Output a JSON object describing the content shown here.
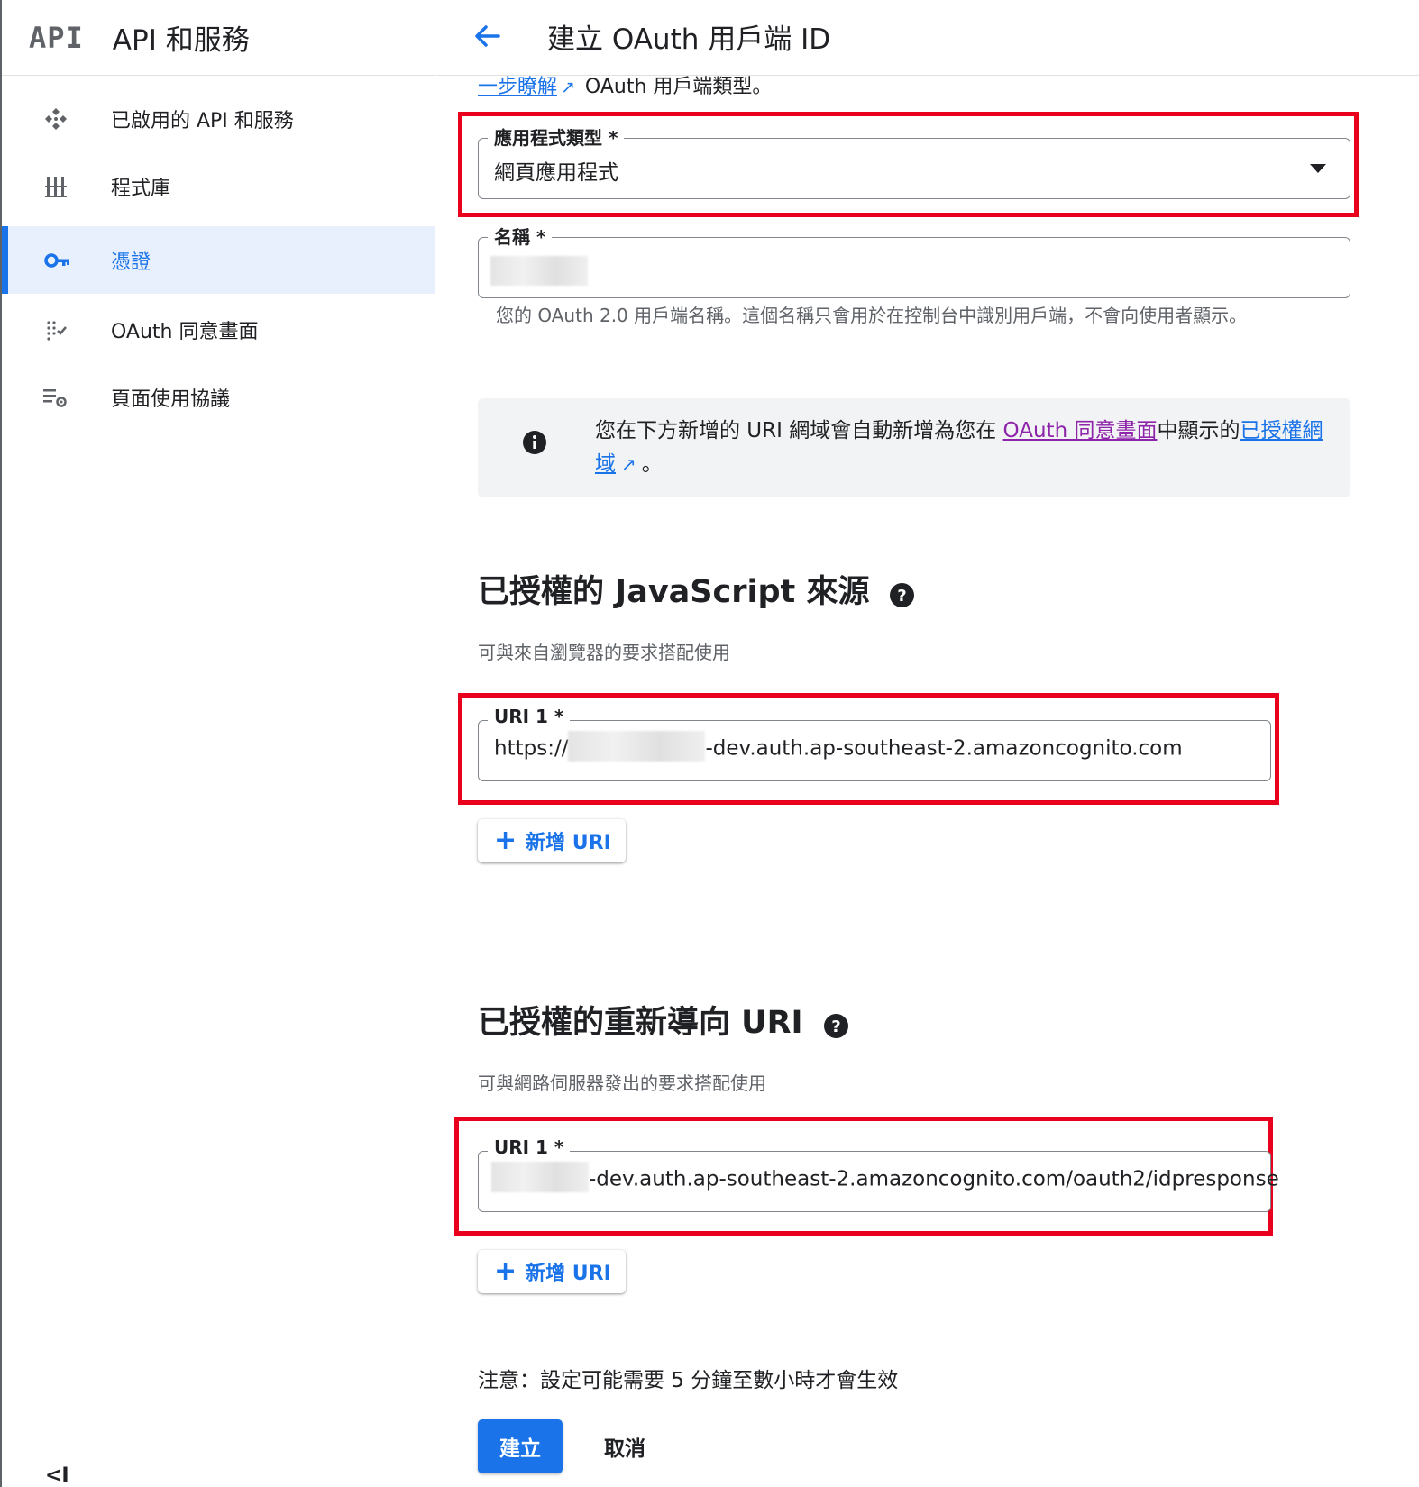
{
  "sidebar": {
    "logo": "API",
    "title": "API 和服務",
    "items": [
      {
        "label": "已啟用的 API 和服務",
        "icon": "api-hub-icon",
        "active": false
      },
      {
        "label": "程式庫",
        "icon": "library-icon",
        "active": false
      },
      {
        "label": "憑證",
        "icon": "key-icon",
        "active": true
      },
      {
        "label": "OAuth 同意畫面",
        "icon": "consent-icon",
        "active": false
      },
      {
        "label": "頁面使用協議",
        "icon": "settings-list-icon",
        "active": false
      }
    ],
    "collapse_label": "<I"
  },
  "header": {
    "title": "建立 OAuth 用戶端 ID"
  },
  "form": {
    "learn_more_link": "一步瞭解",
    "learn_more_suffix": " OAuth 用戶端類型。",
    "app_type": {
      "label": "應用程式類型 *",
      "value": "網頁應用程式"
    },
    "name": {
      "label": "名稱 *"
    },
    "name_hint": "您的 OAuth 2.0 用戶端名稱。這個名稱只會用於在控制台中識別用戶端，不會向使用者顯示。",
    "info": {
      "prefix": "您在下方新增的 URI 網域會自動新增為您在 ",
      "consent_link": "OAuth 同意畫面",
      "middle": "中顯示的",
      "domains_link": "已授權網域",
      "suffix": "。"
    },
    "js_origins": {
      "title": "已授權的 JavaScript 來源",
      "subtitle": "可與來自瀏覽器的要求搭配使用",
      "uri_label": "URI 1 *",
      "uri_prefix": "https://",
      "uri_suffix": "-dev.auth.ap-southeast-2.amazoncognito.com",
      "add_label": "新增 URI"
    },
    "redirect_uris": {
      "title": "已授權的重新導向 URI",
      "subtitle": "可與網路伺服器發出的要求搭配使用",
      "uri_label": "URI 1 *",
      "uri_suffix": "-dev.auth.ap-southeast-2.amazoncognito.com/oauth2/idpresponse",
      "add_label": "新增 URI"
    },
    "note": "注意：設定可能需要 5 分鐘至數小時才會生效",
    "create_label": "建立",
    "cancel_label": "取消"
  },
  "colors": {
    "accent": "#1a73e8",
    "highlight_box": "#e8001c",
    "visited_link": "#8e24aa"
  }
}
